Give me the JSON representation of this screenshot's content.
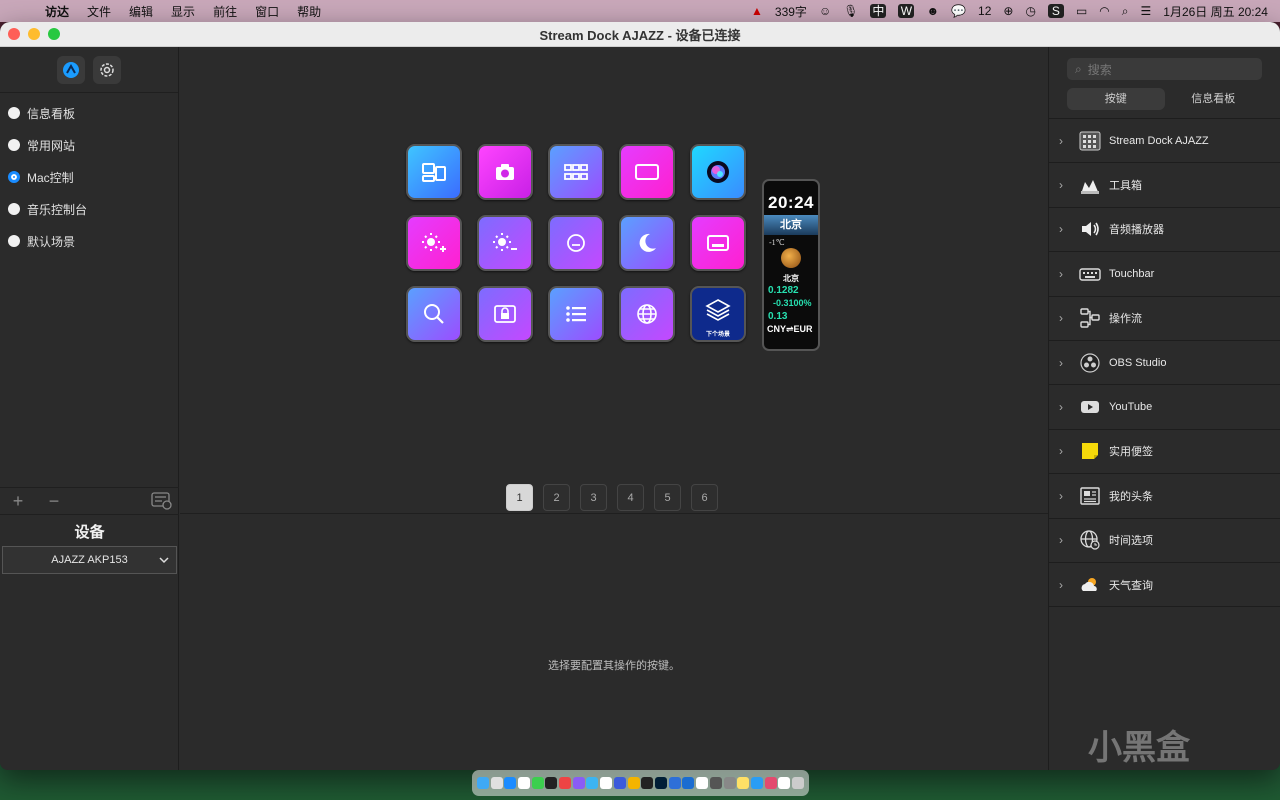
{
  "menubar": {
    "items": [
      "访达",
      "文件",
      "编辑",
      "显示",
      "前往",
      "窗口",
      "帮助"
    ],
    "status": {
      "word_count": "339字",
      "wechat_count": "12",
      "datetime": "1月26日 周五  20:24"
    }
  },
  "window": {
    "title": "Stream Dock AJAZZ - 设备已连接"
  },
  "sidebar": {
    "profiles": [
      {
        "label": "信息看板",
        "selected": false
      },
      {
        "label": "常用网站",
        "selected": false
      },
      {
        "label": "Mac控制",
        "selected": true
      },
      {
        "label": "音乐控制台",
        "selected": false
      },
      {
        "label": "默认场景",
        "selected": false
      }
    ],
    "add_label": "+",
    "remove_label": "−",
    "device_heading": "设备",
    "device_selected": "AJAZZ AKP153"
  },
  "keys": [
    {
      "icon": "window-layout-icon",
      "style": "g-blue"
    },
    {
      "icon": "camera-icon",
      "style": "g-mag"
    },
    {
      "icon": "app-grid-icon",
      "style": "g-violet"
    },
    {
      "icon": "screen-icon",
      "style": "g-pink"
    },
    {
      "icon": "siri-icon",
      "style": "g-cyan"
    },
    {
      "icon": "brightness-up-icon",
      "style": "g-pink"
    },
    {
      "icon": "brightness-down-icon",
      "style": "g-lav"
    },
    {
      "icon": "screensaver-icon",
      "style": "g-lav"
    },
    {
      "icon": "moon-icon",
      "style": "g-violet"
    },
    {
      "icon": "display-icon",
      "style": "g-pink"
    },
    {
      "icon": "search-icon",
      "style": "g-violet"
    },
    {
      "icon": "lock-screen-icon",
      "style": "g-lav"
    },
    {
      "icon": "list-icon",
      "style": "g-violet"
    },
    {
      "icon": "globe-icon",
      "style": "g-lav"
    },
    {
      "icon": "layers-icon",
      "style": "g-navy",
      "caption": "下个场景"
    }
  ],
  "touchstrip": {
    "time": "20:24",
    "city": "北京",
    "temperature": "-1℃",
    "city_small": "北京",
    "rate": "0.1282",
    "change": "-0.3100%",
    "rate2": "0.13",
    "pair": "CNY⇌EUR"
  },
  "pages": [
    "1",
    "2",
    "3",
    "4",
    "5",
    "6"
  ],
  "active_page": "1",
  "hint": "选择要配置其操作的按键。",
  "right_panel": {
    "search_placeholder": "搜索",
    "tabs": [
      "按键",
      "信息看板"
    ],
    "plugins": [
      {
        "label": "Stream Dock AJAZZ",
        "icon": "keypad-icon"
      },
      {
        "label": "工具箱",
        "icon": "toolbox-icon"
      },
      {
        "label": "音频播放器",
        "icon": "speaker-icon"
      },
      {
        "label": "Touchbar",
        "icon": "keyboard-icon"
      },
      {
        "label": "操作流",
        "icon": "workflow-icon"
      },
      {
        "label": "OBS Studio",
        "icon": "obs-icon"
      },
      {
        "label": "YouTube",
        "icon": "youtube-icon"
      },
      {
        "label": "实用便签",
        "icon": "sticky-note-icon"
      },
      {
        "label": "我的头条",
        "icon": "news-icon"
      },
      {
        "label": "时间选项",
        "icon": "world-clock-icon"
      },
      {
        "label": "天气查询",
        "icon": "weather-icon"
      }
    ]
  },
  "watermark": "小黑盒"
}
